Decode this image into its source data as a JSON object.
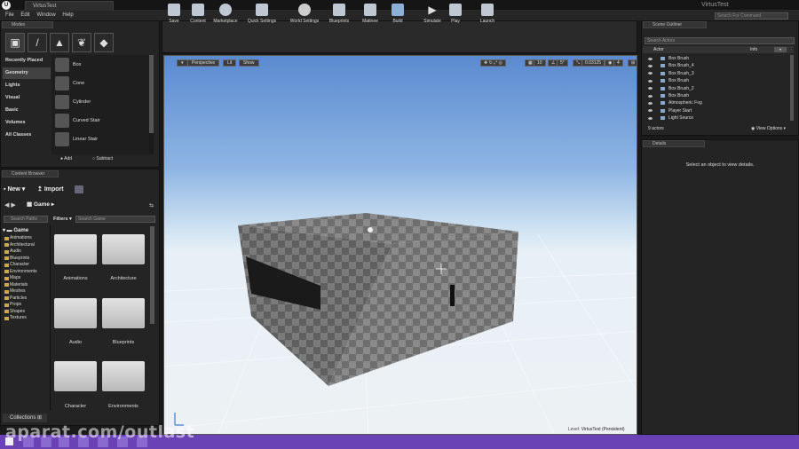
{
  "window": {
    "tab_title": "VirtusTest",
    "app_title": "VirtusTest",
    "search_placeholder": "Search For Command"
  },
  "menu": [
    "File",
    "Edit",
    "Window",
    "Help"
  ],
  "modes": {
    "tab": "Modes",
    "categories": [
      "Recently Placed",
      "Geometry",
      "Lights",
      "Visual",
      "Basic",
      "Volumes",
      "All Classes"
    ],
    "active_category": "Geometry",
    "items": [
      "Box",
      "Cone",
      "Cylinder",
      "Curved Stair",
      "Linear Stair"
    ],
    "add_label": "Add",
    "subtract_label": "Subtract"
  },
  "content_browser": {
    "tab": "Content Browser",
    "new_label": "New",
    "import_label": "Import",
    "path": "Game",
    "search_paths_placeholder": "Search Paths",
    "filters_label": "Filters",
    "search_game_placeholder": "Search Game",
    "tree_root": "Game",
    "tree_folders": [
      "Animations",
      "Architectural",
      "Audio",
      "Blueprints",
      "Character",
      "Environments",
      "Maps",
      "Materials",
      "Meshes",
      "Particles",
      "Props",
      "Shapes",
      "Textures"
    ],
    "tiles": [
      "Animations",
      "Architecture",
      "Audio",
      "Blueprints",
      "Character",
      "Environments"
    ],
    "collections_label": "Collections"
  },
  "toolbar": [
    {
      "label": "Save",
      "icon": "save-icon"
    },
    {
      "label": "Content",
      "icon": "content-icon"
    },
    {
      "label": "Marketplace",
      "icon": "marketplace-icon"
    },
    {
      "label": "Quick Settings",
      "icon": "quick-settings-icon"
    },
    {
      "label": "World Settings",
      "icon": "world-settings-icon"
    },
    {
      "label": "Blueprints",
      "icon": "blueprints-icon"
    },
    {
      "label": "Matinee",
      "icon": "matinee-icon"
    },
    {
      "label": "Build",
      "icon": "build-icon"
    },
    {
      "label": "Simulate",
      "icon": "simulate-icon"
    },
    {
      "label": "Play",
      "icon": "play-icon"
    },
    {
      "label": "Launch",
      "icon": "launch-icon"
    }
  ],
  "viewport": {
    "perspective_label": "Perspective",
    "lit_label": "Lit",
    "show_label": "Show",
    "snap_grid": "10",
    "snap_rotation": "5°",
    "snap_scale": "0.03125",
    "camera_speed": "4",
    "level_label": "Level:",
    "level_name": "VirtusTest (Persistent)"
  },
  "outliner": {
    "tab": "Scene Outliner",
    "search_placeholder": "Search Actors",
    "col_actor": "Actor",
    "col_info": "Info",
    "actors": [
      "Box Brush",
      "Box Brush_4",
      "Box Brush_3",
      "Box Brush",
      "Box Brush_2",
      "Box Brush",
      "Atmospheric Fog",
      "Player Start",
      "Light Source"
    ],
    "count_label": "9 actors",
    "view_options_label": "View Options"
  },
  "details": {
    "tab": "Details",
    "empty_message": "Select an object to view details."
  },
  "watermark": "aparat.com/outlast"
}
